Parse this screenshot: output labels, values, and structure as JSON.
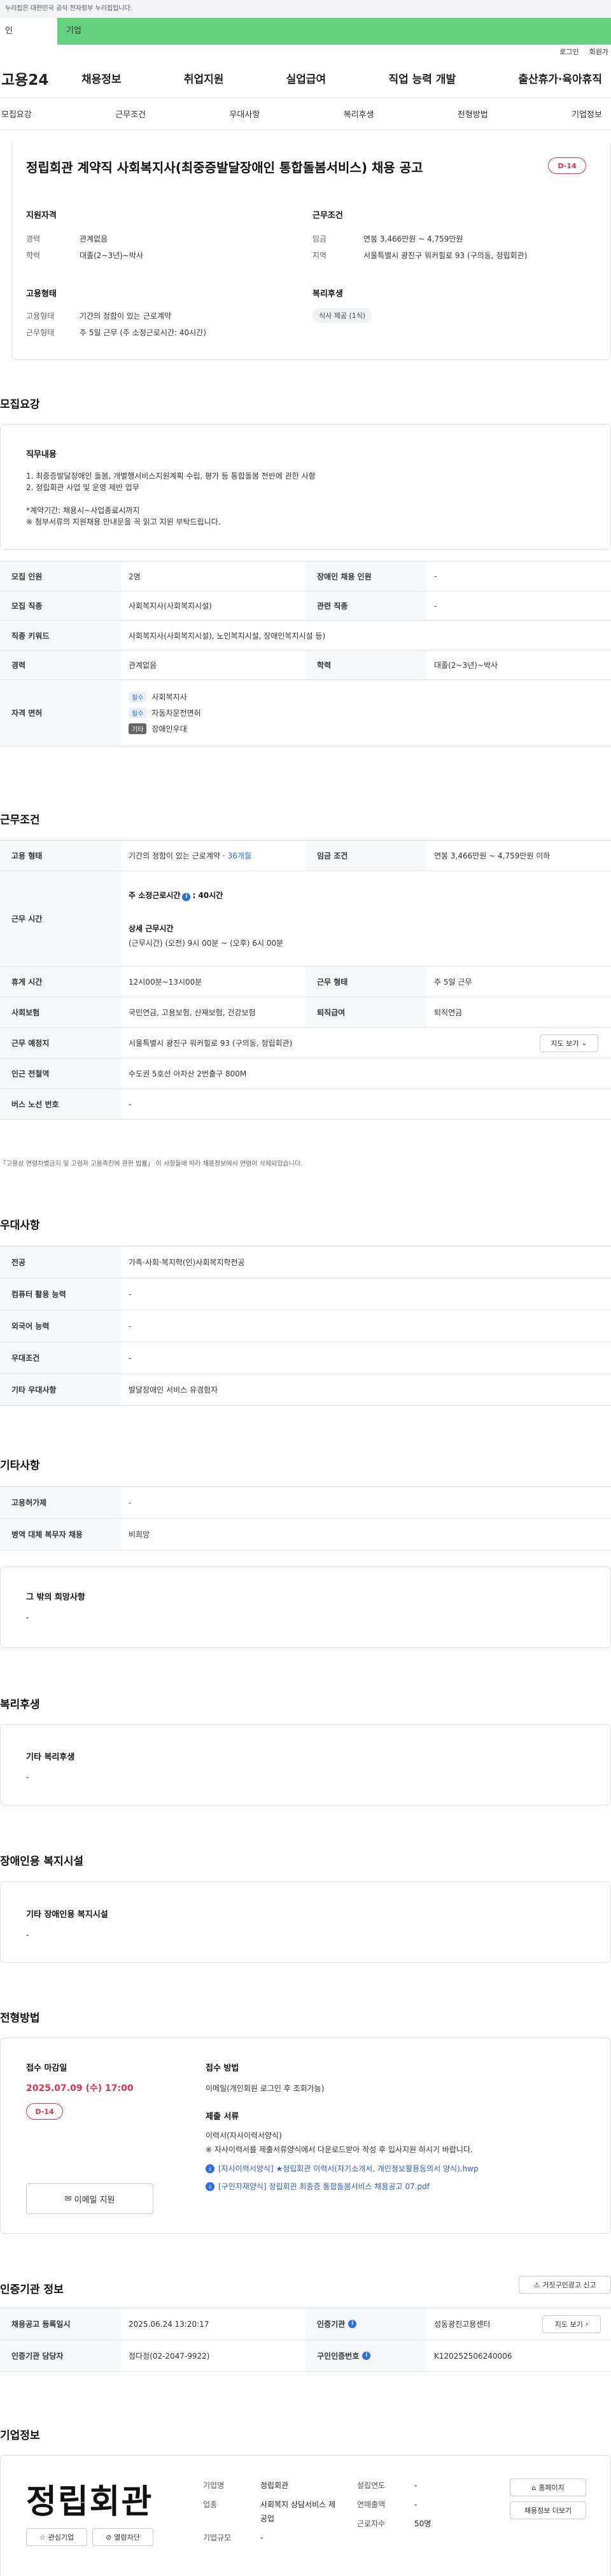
{
  "site_banner": "이 누리집은 대한민국 공식 전자정부 누리집입니다.",
  "site_banner_visible": "누리집은 대한민국 공식 전자정부 누리집입니다.",
  "user_tabs": {
    "personal": "인",
    "company": "기업"
  },
  "util_links": [
    "로그인",
    "회원가"
  ],
  "logo": "고용24",
  "gnb": [
    "채용정보",
    "취업지원",
    "실업급여",
    "직업 능력 개발",
    "출산휴가·육아휴직"
  ],
  "subnav": [
    "모집요강",
    "근무조건",
    "우대사항",
    "복리후생",
    "전형방법",
    "기업정보"
  ],
  "header": {
    "title": "정립회관 계약직 사회복지사(최중증발달장애인 통합돌봄서비스) 채용 공고",
    "dday": "D-14",
    "qualification": {
      "heading": "지원자격",
      "items": [
        {
          "k": "경력",
          "v": "관계없음"
        },
        {
          "k": "학력",
          "v": "대졸(2~3년)~박사"
        }
      ]
    },
    "conditions": {
      "heading": "근무조건",
      "items": [
        {
          "k": "임금",
          "v": "연봉 3,466만원 ~ 4,759만원"
        },
        {
          "k": "지역",
          "v": "서울특별시 광진구 워커힐로 93 (구의동, 정립회관)"
        }
      ]
    },
    "employment": {
      "heading": "고용형태",
      "items": [
        {
          "k": "고용형태",
          "v": "기간의 정함이 있는 근로계약"
        },
        {
          "k": "근무형태",
          "v": "주 5일 근무 (주 소정근로시간: 40시간)"
        }
      ]
    },
    "welfare": {
      "heading": "복리후생",
      "tag": "식사 제공 (1식)"
    }
  },
  "recruit": {
    "title": "모집요강",
    "duty_heading": "직무내용",
    "duty_lines": [
      "1. 최중증발달장애인 돌봄, 개별행서비스지원계획 수립, 평가 등 통합돌봄 전반에 관한 사항",
      "2. 정립회관 사업 및 운영 제반 업무",
      "",
      "*계약기간: 채용시~사업종료시까지",
      "※ 첨부서류의 지원채용 안내문을 꼭 읽고 지원 부탁드립니다."
    ],
    "rows": [
      {
        "l1": "모집 인원",
        "v1": "2명",
        "l2": "장애인 채용 인원",
        "v2": "-"
      },
      {
        "l1": "모집 직종",
        "v1": "사회복지사(사회복지시설)",
        "l2": "관련 직종",
        "v2": "-"
      }
    ],
    "keyword_label": "직종 키워드",
    "keyword_value": "사회복지사(사회복지시설), 노인복지시설, 장애인복지시설 등)",
    "career_label": "경력",
    "career_value": "관계없음",
    "edu_label": "학력",
    "edu_value": "대졸(2~3년)~박사",
    "license_label": "자격 면허",
    "licenses": [
      {
        "badge": "필수",
        "name": "사회복지사"
      },
      {
        "badge": "필수",
        "name": "자동차운전면허"
      },
      {
        "badge": "기타",
        "name": "장애인우대"
      }
    ]
  },
  "work": {
    "title": "근무조건",
    "type_label": "고용 형태",
    "type_value": "기간의 정함이 있는 근로계약 · ",
    "type_months": "36개월",
    "wage_label": "임금 조건",
    "wage_value": "연봉 3,466만원 ~ 4,759만원 이하",
    "hours_label": "근무 시간",
    "hours_main": "주 소정근로시간",
    "hours_main_val": ": 40시간",
    "hours_detail_head": "상세 근무시간",
    "hours_detail": "(근무시간) (오전) 9시 00분 ~ (오후) 6시 00분",
    "break_label": "휴게 시간",
    "break_value": "12시00분~13시00분",
    "shift_label": "근무 형태",
    "shift_value": "주 5일 근무",
    "insurance_label": "사회보험",
    "insurance_value": "국민연금, 고용보험, 산재보험, 건강보험",
    "retire_label": "퇴직급여",
    "retire_value": "퇴직연금",
    "place_label": "근무 예정지",
    "place_value": "서울특별시 광진구 워커힐로 93 (구의동, 정립회관)",
    "map_btn": "지도 보기",
    "subway_label": "인근 전철역",
    "subway_value": "수도권 5호선 아차산 2번출구 800M",
    "bus_label": "버스 노선 번호",
    "bus_value": "-",
    "footnote": "「고용상 연령차별금지 및 고령자 고용촉진에 관한 법률」 이 사항들에 따라 채용정보에서 연령이 삭제되었습니다."
  },
  "pref": {
    "title": "우대사항",
    "rows": [
      {
        "l": "전공",
        "v": "가족·사회·복지학(인)사회복지학전공"
      },
      {
        "l": "컴퓨터 활용 능력",
        "v": "-"
      },
      {
        "l": "외국어 능력",
        "v": "-"
      },
      {
        "l": "우대조건",
        "v": "-"
      },
      {
        "l": "기타 우대사항",
        "v": "발달장애인 서비스 유경험자"
      }
    ]
  },
  "etc": {
    "title": "기타사항",
    "rows": [
      {
        "l": "고용허가제",
        "v": "-"
      },
      {
        "l": "병역 대체 복무자 채용",
        "v": "비희망"
      }
    ],
    "other_heading": "그 밖의 희망사항",
    "other_value": "-"
  },
  "benefit": {
    "title": "복리후생",
    "heading": "기타 복리후생",
    "value": "-"
  },
  "facility": {
    "title": "장애인용 복지시설",
    "heading": "기타 장애인용 복지시설",
    "value": "-"
  },
  "process": {
    "title": "전형방법",
    "deadline_label": "접수 마감일",
    "deadline": "2025.07.09 (수) 17:00",
    "dday": "D-14",
    "apply_btn": "이메일 지원",
    "method_label": "접수 방법",
    "method": "이메일(개인회원 로그인 후 조회가능)",
    "docs_label": "제출 서류",
    "docs_line1": "이력서(자사이력서양식)",
    "docs_line2": "※ 자사이력서를 제출서류양식에서 다운로드받아 작성 후 입사지원 하시기 바랍니다.",
    "files": [
      "[자사이력서양식] ★정립회관 이력서(자기소개서, 개인정보활용동의서 양식).hwp",
      "[구인자재양식] 정립회관 최중증 통합돌봄서비스 채용공고 07.pdf"
    ]
  },
  "cert": {
    "title": "인증기관 정보",
    "report_btn": "거짓구인광고 신고",
    "rows": [
      {
        "l1": "채용공고 등록일시",
        "v1": "2025.06.24 13:20:17",
        "l2": "인증기관",
        "v2": "성동광진고용센터",
        "btn": "지도 보기"
      },
      {
        "l1": "인증기관 담당자",
        "v1": "정다정(02-2047-9922)",
        "l2": "구인인증번호",
        "v2": "K120252506240006",
        "btn": ""
      }
    ]
  },
  "company": {
    "title": "기업정보",
    "logo_text": "정립회관",
    "interest_btn": "관심기업",
    "block_btn": "열람차단",
    "name_label": "기업명",
    "name": "정립회관",
    "industry_label": "업종",
    "industry": "사회복지 상담서비스 제공업",
    "size_label": "기업규모",
    "size": "-",
    "founded_label": "설립연도",
    "founded": "-",
    "revenue_label": "연매출액",
    "revenue": "-",
    "staff_label": "근로자수",
    "staff": "50명",
    "homepage_btn": "홈페이지",
    "jobs_btn": "채용정보 더보기"
  }
}
